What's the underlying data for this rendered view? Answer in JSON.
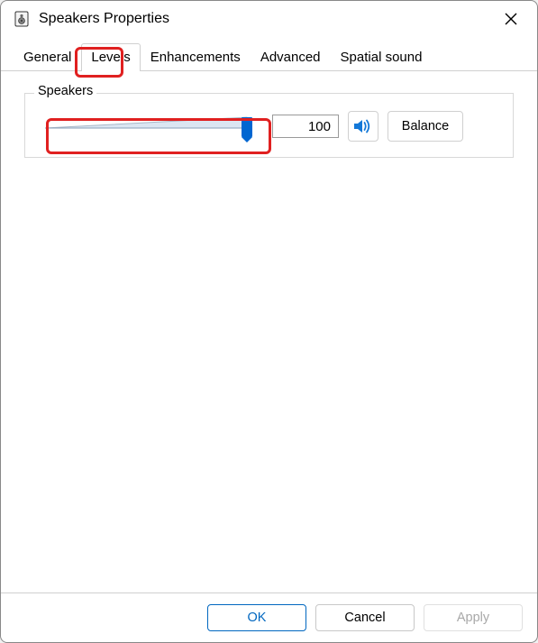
{
  "window": {
    "title": "Speakers Properties"
  },
  "tabs": {
    "items": [
      {
        "label": "General",
        "active": false
      },
      {
        "label": "Levels",
        "active": true
      },
      {
        "label": "Enhancements",
        "active": false
      },
      {
        "label": "Advanced",
        "active": false
      },
      {
        "label": "Spatial sound",
        "active": false
      }
    ]
  },
  "levels": {
    "groupLabel": "Speakers",
    "value": "100",
    "sliderPercent": 100,
    "balanceLabel": "Balance"
  },
  "footer": {
    "ok": "OK",
    "cancel": "Cancel",
    "apply": "Apply"
  },
  "colors": {
    "accent": "#0067c0",
    "highlight": "#e02020"
  },
  "icons": {
    "app": "speaker-box-icon",
    "close": "close-icon",
    "mute": "speaker-sound-icon"
  }
}
